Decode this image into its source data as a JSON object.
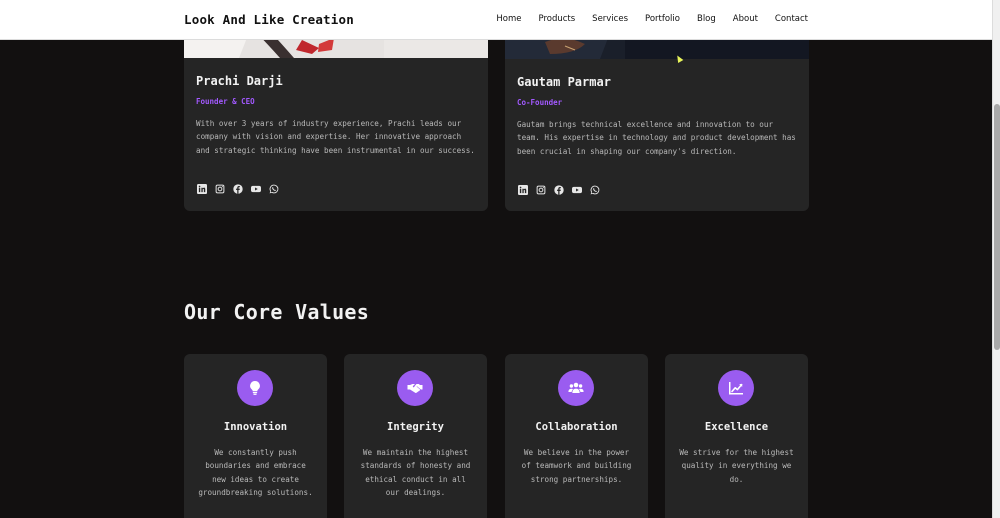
{
  "navbar": {
    "brand": "Look And Like Creation",
    "links": [
      "Home",
      "Products",
      "Services",
      "Portfolio",
      "Blog",
      "About",
      "Contact"
    ]
  },
  "team": [
    {
      "name": "Prachi Darji",
      "role": "Founder & CEO",
      "bio": "With over 3 years of industry experience, Prachi leads our company with vision and expertise. Her innovative approach and strategic thinking have been instrumental in our success.",
      "socials": [
        "linkedin-icon",
        "instagram-icon",
        "facebook-icon",
        "youtube-icon",
        "whatsapp-icon"
      ]
    },
    {
      "name": "Gautam Parmar",
      "role": "Co-Founder",
      "bio": "Gautam brings technical excellence and innovation to our team. His expertise in technology and product development has been crucial in shaping our company's direction.",
      "socials": [
        "linkedin-icon",
        "instagram-icon",
        "facebook-icon",
        "youtube-icon",
        "whatsapp-icon"
      ]
    }
  ],
  "core_values": {
    "title": "Our Core Values",
    "items": [
      {
        "icon": "lightbulb-icon",
        "title": "Innovation",
        "desc": "We constantly push boundaries and embrace new ideas to create groundbreaking solutions."
      },
      {
        "icon": "handshake-icon",
        "title": "Integrity",
        "desc": "We maintain the highest standards of honesty and ethical conduct in all our dealings."
      },
      {
        "icon": "users-icon",
        "title": "Collaboration",
        "desc": "We believe in the power of teamwork and building strong partnerships."
      },
      {
        "icon": "chart-line-icon",
        "title": "Excellence",
        "desc": "We strive for the highest quality in everything we do."
      }
    ]
  },
  "colors": {
    "background": "#121010",
    "card": "#252525",
    "accent": "#9a5cf0",
    "navbar": "#ffffff"
  }
}
